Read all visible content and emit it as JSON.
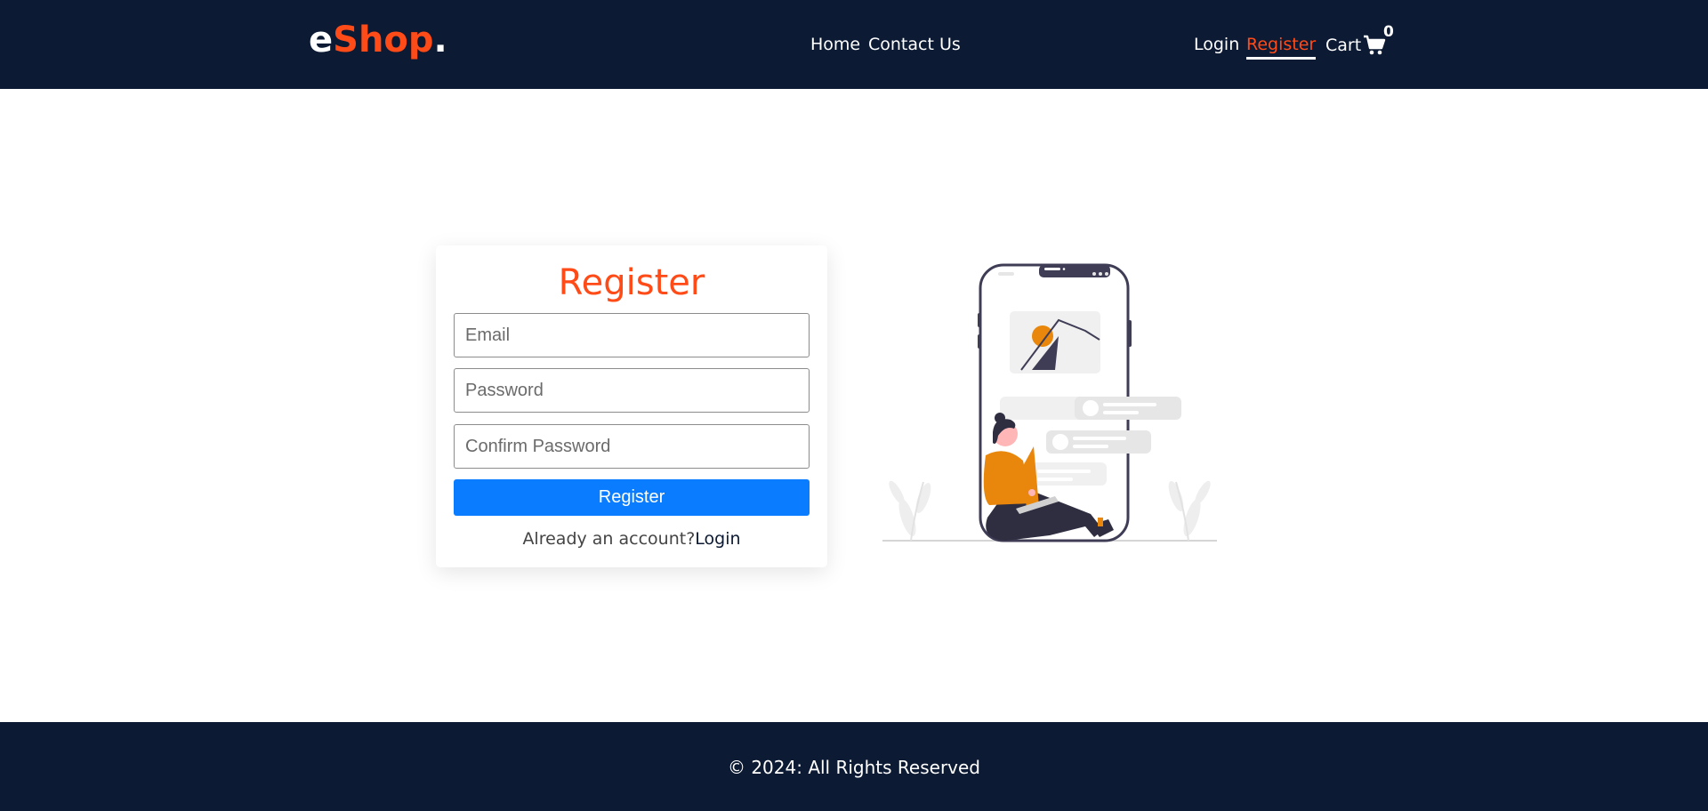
{
  "header": {
    "logo": {
      "prefix": "e",
      "brand": "Shop",
      "suffix": "."
    },
    "nav": {
      "home": "Home",
      "contact": "Contact Us"
    },
    "auth": {
      "login": "Login",
      "register": "Register"
    },
    "cart": {
      "label": "Cart",
      "count": "0",
      "icon": "cart-icon"
    }
  },
  "register_form": {
    "title": "Register",
    "email_placeholder": "Email",
    "password_placeholder": "Password",
    "confirm_placeholder": "Confirm Password",
    "submit_label": "Register",
    "already_text": "Already an account?",
    "login_link": "Login"
  },
  "illustration": {
    "icon": "register-illustration"
  },
  "footer": {
    "copyright": "© 2024: All Rights Reserved"
  },
  "colors": {
    "header_bg": "#0c1a33",
    "accent": "#ff4b17",
    "button": "#0a7cff",
    "illustration_orange": "#e8870c"
  }
}
